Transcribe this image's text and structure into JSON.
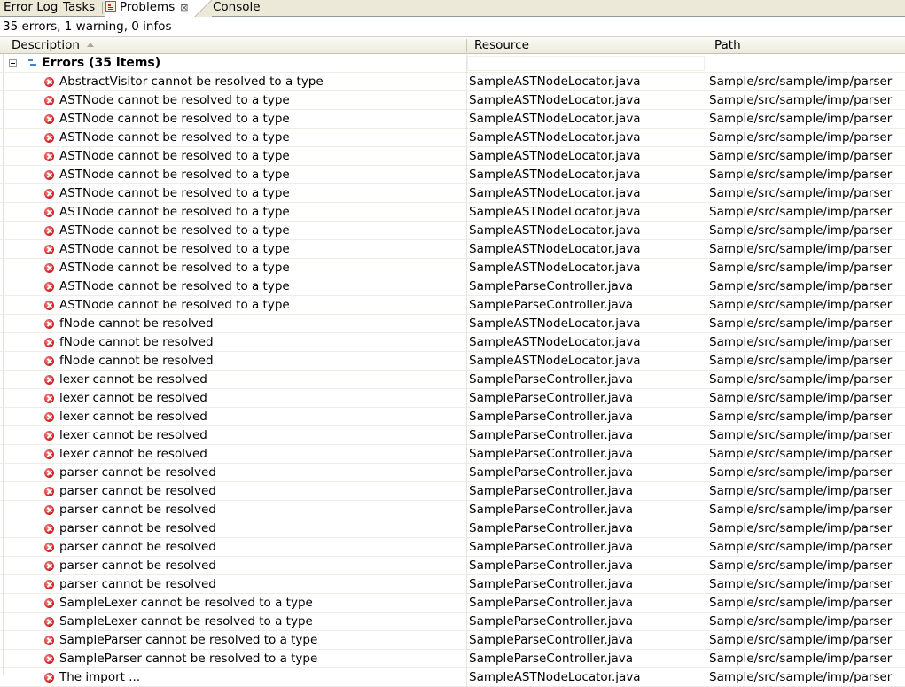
{
  "tabs": [
    {
      "label": "Error Log"
    },
    {
      "label": "Tasks"
    },
    {
      "label": "Problems",
      "close": "⊠"
    },
    {
      "label": "Console"
    }
  ],
  "summary": "35 errors, 1 warning, 0 infos",
  "columns": {
    "description": "Description",
    "resource": "Resource",
    "path": "Path"
  },
  "group": {
    "label": "Errors (35 items)"
  },
  "rows": [
    {
      "description": "AbstractVisitor cannot be resolved to a type",
      "resource": "SampleASTNodeLocator.java",
      "path": "Sample/src/sample/imp/parser"
    },
    {
      "description": "ASTNode cannot be resolved to a type",
      "resource": "SampleASTNodeLocator.java",
      "path": "Sample/src/sample/imp/parser"
    },
    {
      "description": "ASTNode cannot be resolved to a type",
      "resource": "SampleASTNodeLocator.java",
      "path": "Sample/src/sample/imp/parser"
    },
    {
      "description": "ASTNode cannot be resolved to a type",
      "resource": "SampleASTNodeLocator.java",
      "path": "Sample/src/sample/imp/parser"
    },
    {
      "description": "ASTNode cannot be resolved to a type",
      "resource": "SampleASTNodeLocator.java",
      "path": "Sample/src/sample/imp/parser"
    },
    {
      "description": "ASTNode cannot be resolved to a type",
      "resource": "SampleASTNodeLocator.java",
      "path": "Sample/src/sample/imp/parser"
    },
    {
      "description": "ASTNode cannot be resolved to a type",
      "resource": "SampleASTNodeLocator.java",
      "path": "Sample/src/sample/imp/parser"
    },
    {
      "description": "ASTNode cannot be resolved to a type",
      "resource": "SampleASTNodeLocator.java",
      "path": "Sample/src/sample/imp/parser"
    },
    {
      "description": "ASTNode cannot be resolved to a type",
      "resource": "SampleASTNodeLocator.java",
      "path": "Sample/src/sample/imp/parser"
    },
    {
      "description": "ASTNode cannot be resolved to a type",
      "resource": "SampleASTNodeLocator.java",
      "path": "Sample/src/sample/imp/parser"
    },
    {
      "description": "ASTNode cannot be resolved to a type",
      "resource": "SampleASTNodeLocator.java",
      "path": "Sample/src/sample/imp/parser"
    },
    {
      "description": "ASTNode cannot be resolved to a type",
      "resource": "SampleParseController.java",
      "path": "Sample/src/sample/imp/parser"
    },
    {
      "description": "ASTNode cannot be resolved to a type",
      "resource": "SampleParseController.java",
      "path": "Sample/src/sample/imp/parser"
    },
    {
      "description": "fNode cannot be resolved",
      "resource": "SampleASTNodeLocator.java",
      "path": "Sample/src/sample/imp/parser"
    },
    {
      "description": "fNode cannot be resolved",
      "resource": "SampleASTNodeLocator.java",
      "path": "Sample/src/sample/imp/parser"
    },
    {
      "description": "fNode cannot be resolved",
      "resource": "SampleASTNodeLocator.java",
      "path": "Sample/src/sample/imp/parser"
    },
    {
      "description": "lexer cannot be resolved",
      "resource": "SampleParseController.java",
      "path": "Sample/src/sample/imp/parser"
    },
    {
      "description": "lexer cannot be resolved",
      "resource": "SampleParseController.java",
      "path": "Sample/src/sample/imp/parser"
    },
    {
      "description": "lexer cannot be resolved",
      "resource": "SampleParseController.java",
      "path": "Sample/src/sample/imp/parser"
    },
    {
      "description": "lexer cannot be resolved",
      "resource": "SampleParseController.java",
      "path": "Sample/src/sample/imp/parser"
    },
    {
      "description": "lexer cannot be resolved",
      "resource": "SampleParseController.java",
      "path": "Sample/src/sample/imp/parser"
    },
    {
      "description": "parser cannot be resolved",
      "resource": "SampleParseController.java",
      "path": "Sample/src/sample/imp/parser"
    },
    {
      "description": "parser cannot be resolved",
      "resource": "SampleParseController.java",
      "path": "Sample/src/sample/imp/parser"
    },
    {
      "description": "parser cannot be resolved",
      "resource": "SampleParseController.java",
      "path": "Sample/src/sample/imp/parser"
    },
    {
      "description": "parser cannot be resolved",
      "resource": "SampleParseController.java",
      "path": "Sample/src/sample/imp/parser"
    },
    {
      "description": "parser cannot be resolved",
      "resource": "SampleParseController.java",
      "path": "Sample/src/sample/imp/parser"
    },
    {
      "description": "parser cannot be resolved",
      "resource": "SampleParseController.java",
      "path": "Sample/src/sample/imp/parser"
    },
    {
      "description": "parser cannot be resolved",
      "resource": "SampleParseController.java",
      "path": "Sample/src/sample/imp/parser"
    },
    {
      "description": "SampleLexer cannot be resolved to a type",
      "resource": "SampleParseController.java",
      "path": "Sample/src/sample/imp/parser"
    },
    {
      "description": "SampleLexer cannot be resolved to a type",
      "resource": "SampleParseController.java",
      "path": "Sample/src/sample/imp/parser"
    },
    {
      "description": "SampleParser cannot be resolved to a type",
      "resource": "SampleParseController.java",
      "path": "Sample/src/sample/imp/parser"
    },
    {
      "description": "SampleParser cannot be resolved to a type",
      "resource": "SampleParseController.java",
      "path": "Sample/src/sample/imp/parser"
    },
    {
      "description": "The import ...",
      "resource": "SampleASTNodeLocator.java",
      "path": "Sample/src/sample/imp/parser"
    }
  ],
  "icons": {
    "row_icon": "error-icon",
    "group_icon": "hierarchy-icon",
    "expand_icon": "collapse-icon",
    "tab_icon": "problems-icon"
  },
  "colors": {
    "tabbar": "#ece9d8",
    "header": "#ebeadb",
    "error": "#d22a2a"
  }
}
